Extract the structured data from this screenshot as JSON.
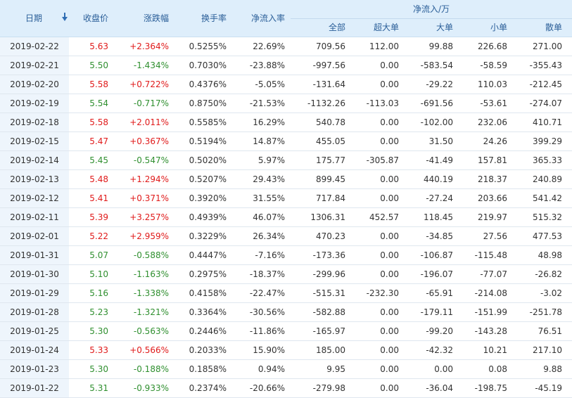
{
  "headers": {
    "date": "日期",
    "close": "收盘价",
    "change": "涨跌幅",
    "turnover": "换手率",
    "net_ratio": "净流入率",
    "net_group": "净流入/万",
    "all": "全部",
    "super_large": "超大单",
    "large": "大单",
    "small": "小单",
    "retail": "散单"
  },
  "colors": {
    "up": "#e01a1a",
    "down": "#2f8f2f",
    "header_bg": "#deeefb",
    "header_text": "#2a5e98"
  },
  "rows": [
    {
      "date": "2019-02-22",
      "close": "5.63",
      "change": "+2.364%",
      "turnover": "0.5255%",
      "net_ratio": "22.69%",
      "all": "709.56",
      "super": "112.00",
      "large": "99.88",
      "small": "226.68",
      "retail": "271.00",
      "dir": "up"
    },
    {
      "date": "2019-02-21",
      "close": "5.50",
      "change": "-1.434%",
      "turnover": "0.7030%",
      "net_ratio": "-23.88%",
      "all": "-997.56",
      "super": "0.00",
      "large": "-583.54",
      "small": "-58.59",
      "retail": "-355.43",
      "dir": "down"
    },
    {
      "date": "2019-02-20",
      "close": "5.58",
      "change": "+0.722%",
      "turnover": "0.4376%",
      "net_ratio": "-5.05%",
      "all": "-131.64",
      "super": "0.00",
      "large": "-29.22",
      "small": "110.03",
      "retail": "-212.45",
      "dir": "up"
    },
    {
      "date": "2019-02-19",
      "close": "5.54",
      "change": "-0.717%",
      "turnover": "0.8750%",
      "net_ratio": "-21.53%",
      "all": "-1132.26",
      "super": "-113.03",
      "large": "-691.56",
      "small": "-53.61",
      "retail": "-274.07",
      "dir": "down"
    },
    {
      "date": "2019-02-18",
      "close": "5.58",
      "change": "+2.011%",
      "turnover": "0.5585%",
      "net_ratio": "16.29%",
      "all": "540.78",
      "super": "0.00",
      "large": "-102.00",
      "small": "232.06",
      "retail": "410.71",
      "dir": "up"
    },
    {
      "date": "2019-02-15",
      "close": "5.47",
      "change": "+0.367%",
      "turnover": "0.5194%",
      "net_ratio": "14.87%",
      "all": "455.05",
      "super": "0.00",
      "large": "31.50",
      "small": "24.26",
      "retail": "399.29",
      "dir": "up"
    },
    {
      "date": "2019-02-14",
      "close": "5.45",
      "change": "-0.547%",
      "turnover": "0.5020%",
      "net_ratio": "5.97%",
      "all": "175.77",
      "super": "-305.87",
      "large": "-41.49",
      "small": "157.81",
      "retail": "365.33",
      "dir": "down"
    },
    {
      "date": "2019-02-13",
      "close": "5.48",
      "change": "+1.294%",
      "turnover": "0.5207%",
      "net_ratio": "29.43%",
      "all": "899.45",
      "super": "0.00",
      "large": "440.19",
      "small": "218.37",
      "retail": "240.89",
      "dir": "up"
    },
    {
      "date": "2019-02-12",
      "close": "5.41",
      "change": "+0.371%",
      "turnover": "0.3920%",
      "net_ratio": "31.55%",
      "all": "717.84",
      "super": "0.00",
      "large": "-27.24",
      "small": "203.66",
      "retail": "541.42",
      "dir": "up"
    },
    {
      "date": "2019-02-11",
      "close": "5.39",
      "change": "+3.257%",
      "turnover": "0.4939%",
      "net_ratio": "46.07%",
      "all": "1306.31",
      "super": "452.57",
      "large": "118.45",
      "small": "219.97",
      "retail": "515.32",
      "dir": "up"
    },
    {
      "date": "2019-02-01",
      "close": "5.22",
      "change": "+2.959%",
      "turnover": "0.3229%",
      "net_ratio": "26.34%",
      "all": "470.23",
      "super": "0.00",
      "large": "-34.85",
      "small": "27.56",
      "retail": "477.53",
      "dir": "up"
    },
    {
      "date": "2019-01-31",
      "close": "5.07",
      "change": "-0.588%",
      "turnover": "0.4447%",
      "net_ratio": "-7.16%",
      "all": "-173.36",
      "super": "0.00",
      "large": "-106.87",
      "small": "-115.48",
      "retail": "48.98",
      "dir": "down"
    },
    {
      "date": "2019-01-30",
      "close": "5.10",
      "change": "-1.163%",
      "turnover": "0.2975%",
      "net_ratio": "-18.37%",
      "all": "-299.96",
      "super": "0.00",
      "large": "-196.07",
      "small": "-77.07",
      "retail": "-26.82",
      "dir": "down"
    },
    {
      "date": "2019-01-29",
      "close": "5.16",
      "change": "-1.338%",
      "turnover": "0.4158%",
      "net_ratio": "-22.47%",
      "all": "-515.31",
      "super": "-232.30",
      "large": "-65.91",
      "small": "-214.08",
      "retail": "-3.02",
      "dir": "down"
    },
    {
      "date": "2019-01-28",
      "close": "5.23",
      "change": "-1.321%",
      "turnover": "0.3364%",
      "net_ratio": "-30.56%",
      "all": "-582.88",
      "super": "0.00",
      "large": "-179.11",
      "small": "-151.99",
      "retail": "-251.78",
      "dir": "down"
    },
    {
      "date": "2019-01-25",
      "close": "5.30",
      "change": "-0.563%",
      "turnover": "0.2446%",
      "net_ratio": "-11.86%",
      "all": "-165.97",
      "super": "0.00",
      "large": "-99.20",
      "small": "-143.28",
      "retail": "76.51",
      "dir": "down"
    },
    {
      "date": "2019-01-24",
      "close": "5.33",
      "change": "+0.566%",
      "turnover": "0.2033%",
      "net_ratio": "15.90%",
      "all": "185.00",
      "super": "0.00",
      "large": "-42.32",
      "small": "10.21",
      "retail": "217.10",
      "dir": "up"
    },
    {
      "date": "2019-01-23",
      "close": "5.30",
      "change": "-0.188%",
      "turnover": "0.1858%",
      "net_ratio": "0.94%",
      "all": "9.95",
      "super": "0.00",
      "large": "0.00",
      "small": "0.08",
      "retail": "9.88",
      "dir": "down"
    },
    {
      "date": "2019-01-22",
      "close": "5.31",
      "change": "-0.933%",
      "turnover": "0.2374%",
      "net_ratio": "-20.66%",
      "all": "-279.98",
      "super": "0.00",
      "large": "-36.04",
      "small": "-198.75",
      "retail": "-45.19",
      "dir": "down"
    }
  ]
}
